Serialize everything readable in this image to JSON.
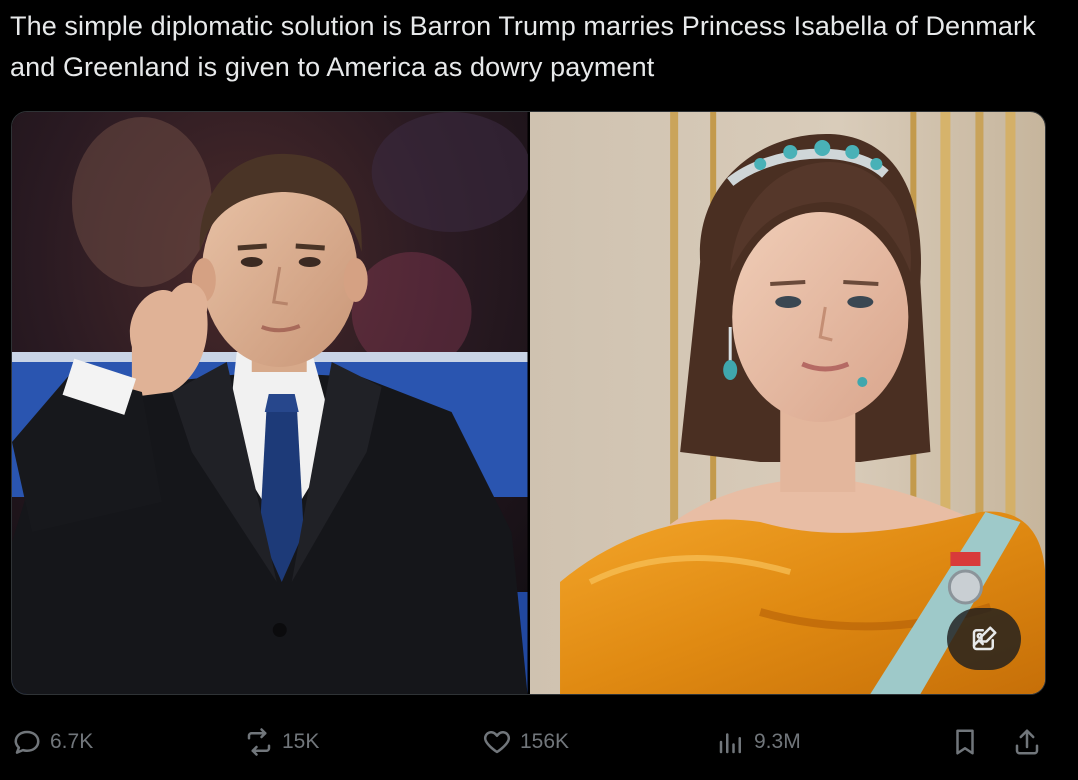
{
  "post": {
    "text": "The simple diplomatic solution is Barron Trump marries Princess Isabella of Denmark and Greenland is given to America as dowry payment"
  },
  "actions": {
    "replies": "6.7K",
    "reposts": "15K",
    "likes": "156K",
    "views": "9.3M"
  },
  "colors": {
    "background": "#000000",
    "text": "#e7e9ea",
    "muted": "#71767b",
    "border": "#2f3336"
  }
}
